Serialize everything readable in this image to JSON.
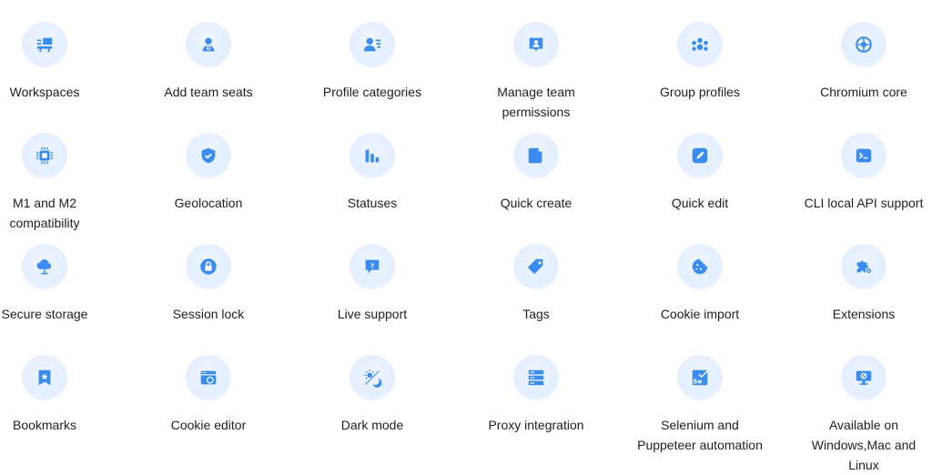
{
  "accent_color": "#3b8cf0",
  "features": [
    {
      "id": "workspaces",
      "label": "Workspaces",
      "icon": "workspace-icon"
    },
    {
      "id": "add-team-seats",
      "label": "Add team seats",
      "icon": "add-user-icon"
    },
    {
      "id": "profile-categories",
      "label": "Profile categories",
      "icon": "profile-list-icon"
    },
    {
      "id": "manage-team-permissions",
      "label": "Manage team\npermissions",
      "icon": "permission-badge-icon"
    },
    {
      "id": "group-profiles",
      "label": "Group profiles",
      "icon": "group-icon"
    },
    {
      "id": "chromium-core",
      "label": "Chromium core",
      "icon": "chromium-icon"
    },
    {
      "id": "m1-m2",
      "label": "M1 and M2\ncompatibility",
      "icon": "chip-icon"
    },
    {
      "id": "geolocation",
      "label": "Geolocation",
      "icon": "shield-check-icon"
    },
    {
      "id": "statuses",
      "label": "Statuses",
      "icon": "bar-chart-icon"
    },
    {
      "id": "quick-create",
      "label": "Quick create",
      "icon": "document-icon"
    },
    {
      "id": "quick-edit",
      "label": "Quick edit",
      "icon": "pencil-icon"
    },
    {
      "id": "cli-local-api",
      "label": "CLI local API support",
      "icon": "terminal-icon"
    },
    {
      "id": "secure-storage",
      "label": "Secure storage",
      "icon": "cloud-upload-icon"
    },
    {
      "id": "session-lock",
      "label": "Session lock",
      "icon": "lock-icon"
    },
    {
      "id": "live-support",
      "label": "Live support",
      "icon": "chat-question-icon"
    },
    {
      "id": "tags",
      "label": "Tags",
      "icon": "tag-icon"
    },
    {
      "id": "cookie-import",
      "label": "Cookie import",
      "icon": "cookie-icon"
    },
    {
      "id": "extensions",
      "label": "Extensions",
      "icon": "puzzle-gear-icon"
    },
    {
      "id": "bookmarks",
      "label": "Bookmarks",
      "icon": "bookmark-star-icon"
    },
    {
      "id": "cookie-editor",
      "label": "Cookie editor",
      "icon": "browser-window-cookie-icon"
    },
    {
      "id": "dark-mode",
      "label": "Dark mode",
      "icon": "sun-moon-icon"
    },
    {
      "id": "proxy-integration",
      "label": "Proxy integration",
      "icon": "server-icon"
    },
    {
      "id": "selenium-puppeteer",
      "label": "Selenium and\nPuppeteer automation",
      "icon": "selenium-icon"
    },
    {
      "id": "cross-platform",
      "label": "Available on\nWindows,Mac and\nLinux",
      "icon": "monitor-icon"
    }
  ]
}
